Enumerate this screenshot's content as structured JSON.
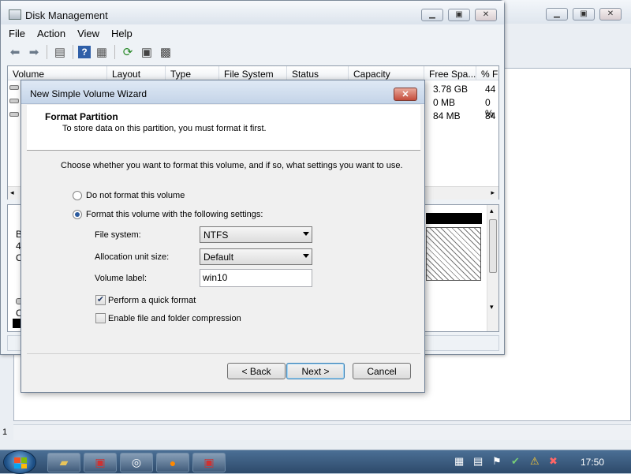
{
  "disk_management": {
    "title": "Disk Management",
    "menu": [
      "File",
      "Action",
      "View",
      "Help"
    ],
    "columns": [
      "Volume",
      "Layout",
      "Type",
      "File System",
      "Status",
      "Capacity",
      "Free Spa...",
      "% F"
    ],
    "rows": [
      {
        "free_space": "3.78 GB",
        "percent_free": "44"
      },
      {
        "free_space": "0 MB",
        "percent_free": "0 %"
      },
      {
        "free_space": "84 MB",
        "percent_free": "84"
      }
    ],
    "lower_left_fragments": [
      "B",
      "4(",
      "O",
      "C"
    ]
  },
  "wizard": {
    "title": "New Simple Volume Wizard",
    "close_label": "✕",
    "header_title": "Format Partition",
    "header_subtitle": "To store data on this partition, you must format it first.",
    "intro": "Choose whether you want to format this volume, and if so, what settings you want to use.",
    "radio_no_format": "Do not format this volume",
    "radio_format": "Format this volume with the following settings:",
    "file_system_label": "File system:",
    "file_system_value": "NTFS",
    "alloc_label": "Allocation unit size:",
    "alloc_value": "Default",
    "volume_label_label": "Volume label:",
    "volume_label_value": "win10",
    "quick_format_label": "Perform a quick format",
    "quick_format_checked": true,
    "compression_label": "Enable file and folder compression",
    "compression_checked": false,
    "back_button": "< Back",
    "next_button": "Next >",
    "cancel_button": "Cancel"
  },
  "taskbar": {
    "clock": "17:50",
    "status_left": "1"
  }
}
